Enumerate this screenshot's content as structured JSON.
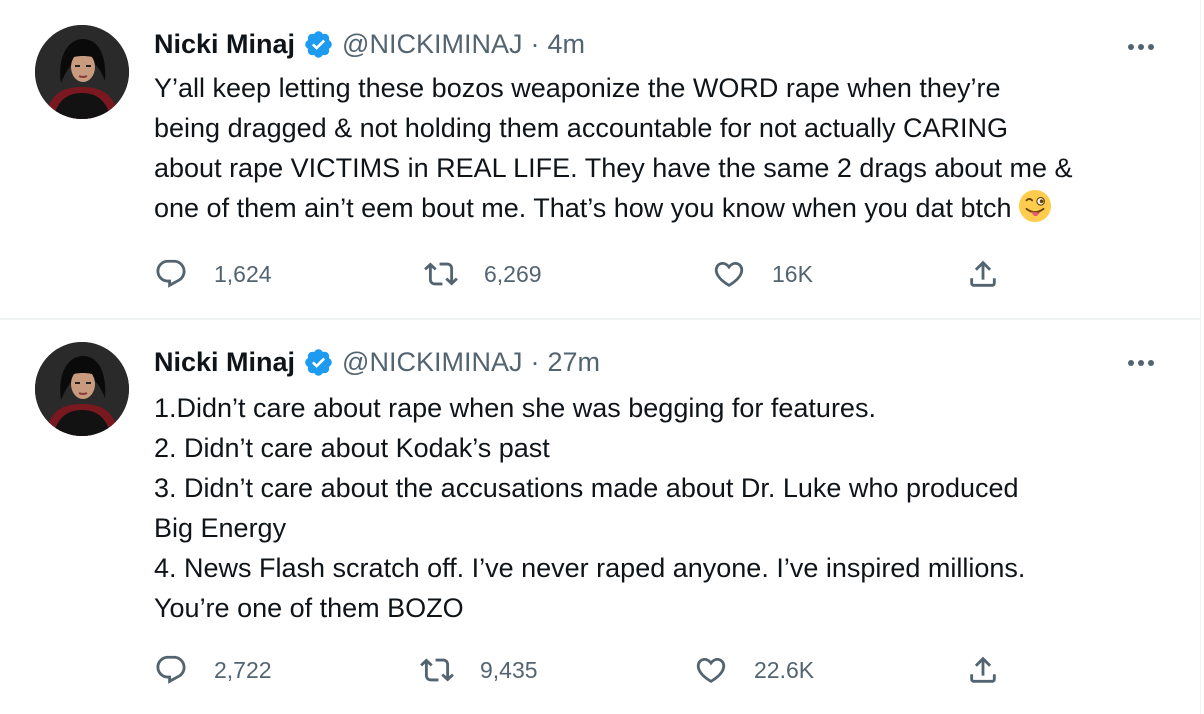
{
  "tweets": [
    {
      "author": {
        "name": "Nicki Minaj",
        "handle": "@NICKIMINAJ",
        "verified": true
      },
      "separator": "·",
      "time": "4m",
      "lines": [
        "Y’all keep letting these bozos weaponize the WORD rape when they’re",
        "being dragged & not holding them accountable for not actually CARING",
        "about rape VICTIMS in REAL LIFE. They have the same 2 drags about me &",
        "one of them ain’t eem bout me. That’s how you know when you dat btch"
      ],
      "trailing_emoji": "winking-face-with-tongue",
      "replies": "1,624",
      "retweets": "6,269",
      "likes": "16K"
    },
    {
      "author": {
        "name": "Nicki Minaj",
        "handle": "@NICKIMINAJ",
        "verified": true
      },
      "separator": "·",
      "time": "27m",
      "lines": [
        "1.Didn’t care about rape when she was begging for features.",
        "2. Didn’t care about Kodak’s past",
        "3. Didn’t care about the accusations made about Dr. Luke who produced",
        "Big Energy",
        "4. News Flash scratch off. I’ve never raped anyone. I’ve inspired millions.",
        "You’re one of them BOZO"
      ],
      "replies": "2,722",
      "retweets": "9,435",
      "likes": "22.6K"
    }
  ],
  "colors": {
    "text": "#0f1419",
    "secondary": "#536471",
    "verified_blue": "#1d9bf0",
    "divider": "#eff3f4"
  },
  "icons": [
    "verified-badge-icon",
    "more-icon",
    "reply-icon",
    "retweet-icon",
    "like-icon",
    "share-icon"
  ]
}
